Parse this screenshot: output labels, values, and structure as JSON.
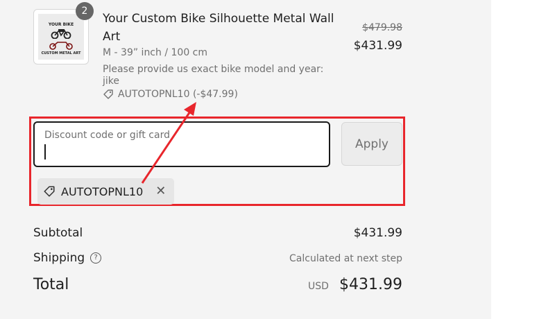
{
  "product": {
    "thumb_top_text": "YOUR BIKE",
    "thumb_bottom_text": "CUSTOM METAL ART",
    "quantity": "2",
    "title": "Your Custom Bike Silhouette Metal Wall Art",
    "variant": "M - 39”  inch / 100 cm",
    "note": "Please provide us exact bike model and year: jike",
    "discount_line": "AUTOTOPNL10 (-$47.99)",
    "price_original": "$479.98",
    "price_discounted": "$431.99"
  },
  "discount": {
    "input_label": "Discount code or gift card",
    "input_value": "",
    "apply_label": "Apply",
    "applied_code": "AUTOTOPNL10"
  },
  "summary": {
    "subtotal_label": "Subtotal",
    "subtotal_value": "$431.99",
    "shipping_label": "Shipping",
    "shipping_value": "Calculated at next step",
    "total_label": "Total",
    "currency": "USD",
    "total_value": "$431.99"
  },
  "colors": {
    "annotation_red": "#e8262c",
    "panel_bg": "#f4f4f4"
  }
}
